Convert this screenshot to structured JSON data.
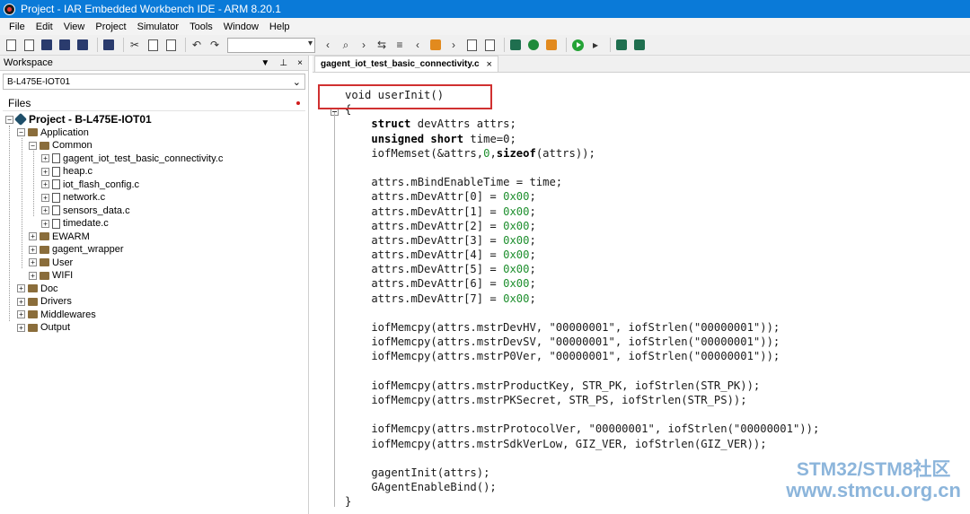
{
  "window": {
    "title": "Project - IAR Embedded Workbench IDE - ARM 8.20.1"
  },
  "menu": [
    "File",
    "Edit",
    "View",
    "Project",
    "Simulator",
    "Tools",
    "Window",
    "Help"
  ],
  "workspace": {
    "title": "Workspace",
    "config": "B-L475E-IOT01",
    "files_header": "Files",
    "project": "Project - B-L475E-IOT01",
    "tree": [
      {
        "label": "Application",
        "level": 1,
        "type": "folder"
      },
      {
        "label": "Common",
        "level": 2,
        "type": "folder"
      },
      {
        "label": "gagent_iot_test_basic_connectivity.c",
        "level": 3,
        "type": "file"
      },
      {
        "label": "heap.c",
        "level": 3,
        "type": "file"
      },
      {
        "label": "iot_flash_config.c",
        "level": 3,
        "type": "file"
      },
      {
        "label": "network.c",
        "level": 3,
        "type": "file"
      },
      {
        "label": "sensors_data.c",
        "level": 3,
        "type": "file"
      },
      {
        "label": "timedate.c",
        "level": 3,
        "type": "file"
      },
      {
        "label": "EWARM",
        "level": 2,
        "type": "folder"
      },
      {
        "label": "gagent_wrapper",
        "level": 2,
        "type": "folder"
      },
      {
        "label": "User",
        "level": 2,
        "type": "folder"
      },
      {
        "label": "WIFI",
        "level": 2,
        "type": "folder"
      },
      {
        "label": "Doc",
        "level": 1,
        "type": "folder"
      },
      {
        "label": "Drivers",
        "level": 1,
        "type": "folder"
      },
      {
        "label": "Middlewares",
        "level": 1,
        "type": "folder"
      },
      {
        "label": "Output",
        "level": 1,
        "type": "folder"
      }
    ]
  },
  "editor": {
    "tab": "gagent_iot_test_basic_connectivity.c",
    "tab_close": "×",
    "code": [
      "void userInit()",
      "{",
      "    struct devAttrs attrs;",
      "    unsigned short time=0;",
      "    iofMemset(&attrs,0,sizeof(attrs));",
      "",
      "    attrs.mBindEnableTime = time;",
      "    attrs.mDevAttr[0] = 0x00;",
      "    attrs.mDevAttr[1] = 0x00;",
      "    attrs.mDevAttr[2] = 0x00;",
      "    attrs.mDevAttr[3] = 0x00;",
      "    attrs.mDevAttr[4] = 0x00;",
      "    attrs.mDevAttr[5] = 0x00;",
      "    attrs.mDevAttr[6] = 0x00;",
      "    attrs.mDevAttr[7] = 0x00;",
      "",
      "    iofMemcpy(attrs.mstrDevHV, \"00000001\", iofStrlen(\"00000001\"));",
      "    iofMemcpy(attrs.mstrDevSV, \"00000001\", iofStrlen(\"00000001\"));",
      "    iofMemcpy(attrs.mstrP0Ver, \"00000001\", iofStrlen(\"00000001\"));",
      "",
      "    iofMemcpy(attrs.mstrProductKey, STR_PK, iofStrlen(STR_PK));",
      "    iofMemcpy(attrs.mstrPKSecret, STR_PS, iofStrlen(STR_PS));",
      "",
      "    iofMemcpy(attrs.mstrProtocolVer, \"00000001\", iofStrlen(\"00000001\"));",
      "    iofMemcpy(attrs.mstrSdkVerLow, GIZ_VER, iofStrlen(GIZ_VER));",
      "",
      "    gagentInit(attrs);",
      "    GAgentEnableBind();",
      "}"
    ]
  },
  "watermark": {
    "line1": "STM32/STM8社区",
    "line2": "www.stmcu.org.cn"
  }
}
